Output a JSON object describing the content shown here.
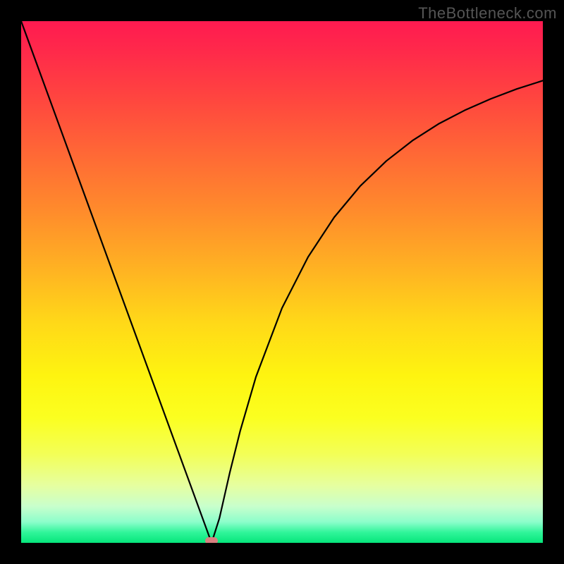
{
  "watermark": "TheBottleneck.com",
  "chart_data": {
    "type": "line",
    "title": "",
    "xlabel": "",
    "ylabel": "",
    "xlim": [
      0,
      100
    ],
    "ylim": [
      0,
      100
    ],
    "grid": false,
    "legend": false,
    "background": {
      "type": "vertical-gradient",
      "description": "red (high) to green (low) bottleneck severity",
      "stops": [
        {
          "pos": 0,
          "color": "#ff1a50"
        },
        {
          "pos": 50,
          "color": "#ffd000"
        },
        {
          "pos": 100,
          "color": "#06e67b"
        }
      ]
    },
    "series": [
      {
        "name": "bottleneck-curve",
        "color": "#000000",
        "x": [
          0,
          5,
          10,
          15,
          20,
          25,
          30,
          33,
          35,
          36.5,
          38,
          40,
          42,
          45,
          50,
          55,
          60,
          65,
          70,
          75,
          80,
          85,
          90,
          95,
          100
        ],
        "y": [
          100,
          86.3,
          72.6,
          58.9,
          45.2,
          31.5,
          17.8,
          9.6,
          4.1,
          0,
          4.7,
          13.5,
          21.5,
          31.8,
          45.0,
          54.8,
          62.4,
          68.4,
          73.2,
          77.1,
          80.3,
          82.9,
          85.1,
          87.0,
          88.6
        ]
      }
    ],
    "annotations": [
      {
        "name": "balance-point-marker",
        "shape": "pill",
        "color": "#d88080",
        "x": 36.5,
        "y": 0
      }
    ]
  }
}
